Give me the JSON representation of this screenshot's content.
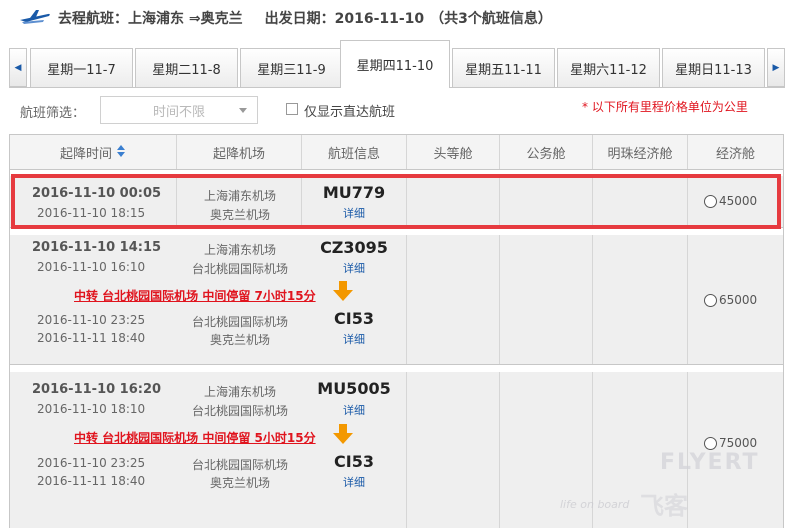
{
  "header": {
    "outbound": "去程航班：",
    "route": "上海浦东 ⇒奥克兰",
    "date_label": "出发日期：",
    "date": "2016-11-10",
    "count": "（共3个航班信息）"
  },
  "tabs": [
    {
      "label": "星期一11-7"
    },
    {
      "label": "星期二11-8"
    },
    {
      "label": "星期三11-9"
    },
    {
      "label": "星期四11-10"
    },
    {
      "label": "星期五11-11"
    },
    {
      "label": "星期六11-12"
    },
    {
      "label": "星期日11-13"
    }
  ],
  "filter": {
    "label": "航班筛选：",
    "select_value": "时间不限",
    "direct_only": "仅显示直达航班",
    "note": "* 以下所有里程价格单位为公里"
  },
  "columns": [
    "起降时间",
    "起降机场",
    "航班信息",
    "头等舱",
    "公务舱",
    "明珠经济舱",
    "经济舱"
  ],
  "flights": [
    {
      "dep_time": "2016-11-10 00:05",
      "arr_time": "2016-11-10 18:15",
      "dep_airport": "上海浦东机场",
      "arr_airport": "奥克兰机场",
      "flight_no": "MU779",
      "detail": "详细",
      "economy_price": "45000"
    },
    {
      "dep_time": "2016-11-10 14:15",
      "arr_time": "2016-11-10 16:10",
      "dep_airport": "上海浦东机场",
      "arr_airport": "台北桃园国际机场",
      "flight_no": "CZ3095",
      "detail": "详细",
      "transfer": "中转 台北桃园国际机场 中间停留 7小时15分",
      "leg2_dep_time": "2016-11-10 23:25",
      "leg2_arr_time": "2016-11-11 18:40",
      "leg2_dep_airport": "台北桃园国际机场",
      "leg2_arr_airport": "奥克兰机场",
      "leg2_flight_no": "CI53",
      "leg2_detail": "详细",
      "economy_price": "65000"
    },
    {
      "dep_time": "2016-11-10 16:20",
      "arr_time": "2016-11-10 18:10",
      "dep_airport": "上海浦东机场",
      "arr_airport": "台北桃园国际机场",
      "flight_no": "MU5005",
      "detail": "详细",
      "transfer": "中转 台北桃园国际机场 中间停留 5小时15分",
      "leg2_dep_time": "2016-11-10 23:25",
      "leg2_arr_time": "2016-11-11 18:40",
      "leg2_dep_airport": "台北桃园国际机场",
      "leg2_arr_airport": "奥克兰机场",
      "leg2_flight_no": "CI53",
      "leg2_detail": "详细",
      "economy_price": "75000"
    }
  ],
  "watermark": {
    "brand": "FLYERT",
    "cn": "飞客",
    "tagline": "life on board"
  },
  "colors": {
    "accent_blue": "#1a5aa8",
    "alert_red": "#e0141e",
    "highlight_box": "#e63a3f",
    "arrow_orange": "#f39800"
  }
}
